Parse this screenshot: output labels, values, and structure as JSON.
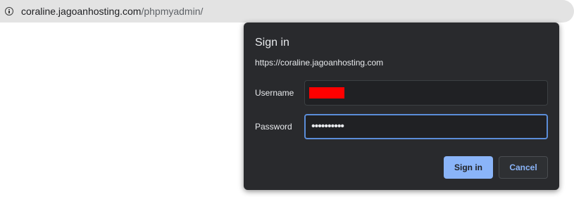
{
  "address_bar": {
    "icon": "info-icon",
    "url_host": "coraline.jagoanhosting.com",
    "url_path": "/phpmyadmin/"
  },
  "dialog": {
    "title": "Sign in",
    "origin": "https://coraline.jagoanhosting.com",
    "username_label": "Username",
    "password_label": "Password",
    "password_masked": "••••••••••",
    "signin_label": "Sign in",
    "cancel_label": "Cancel"
  },
  "colors": {
    "dialog_background": "#292a2d",
    "accent": "#8ab4f8",
    "focus_border": "#5b8dd9",
    "redaction": "#ff0000"
  }
}
